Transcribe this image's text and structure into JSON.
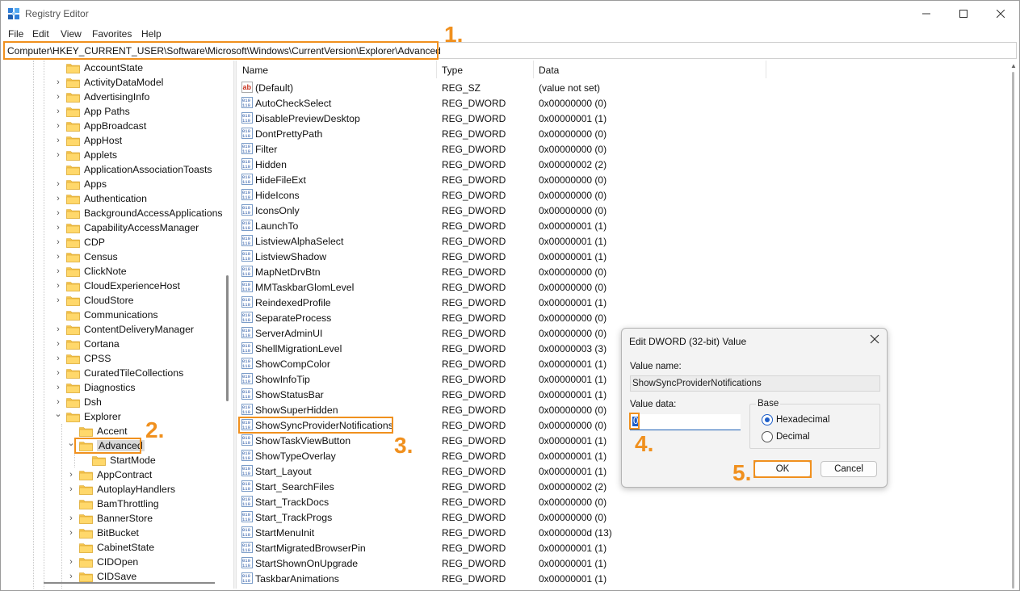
{
  "window": {
    "title": "Registry Editor"
  },
  "menu": [
    "File",
    "Edit",
    "View",
    "Favorites",
    "Help"
  ],
  "address": "Computer\\HKEY_CURRENT_USER\\Software\\Microsoft\\Windows\\CurrentVersion\\Explorer\\Advanced",
  "tree": {
    "items": [
      {
        "label": "AccountState",
        "level": 1,
        "has_children": false
      },
      {
        "label": "ActivityDataModel",
        "level": 1,
        "has_children": true
      },
      {
        "label": "AdvertisingInfo",
        "level": 1,
        "has_children": true
      },
      {
        "label": "App Paths",
        "level": 1,
        "has_children": true
      },
      {
        "label": "AppBroadcast",
        "level": 1,
        "has_children": true
      },
      {
        "label": "AppHost",
        "level": 1,
        "has_children": true
      },
      {
        "label": "Applets",
        "level": 1,
        "has_children": true
      },
      {
        "label": "ApplicationAssociationToasts",
        "level": 1,
        "has_children": false
      },
      {
        "label": "Apps",
        "level": 1,
        "has_children": true
      },
      {
        "label": "Authentication",
        "level": 1,
        "has_children": true
      },
      {
        "label": "BackgroundAccessApplications",
        "level": 1,
        "has_children": true
      },
      {
        "label": "CapabilityAccessManager",
        "level": 1,
        "has_children": true
      },
      {
        "label": "CDP",
        "level": 1,
        "has_children": true
      },
      {
        "label": "Census",
        "level": 1,
        "has_children": true
      },
      {
        "label": "ClickNote",
        "level": 1,
        "has_children": true
      },
      {
        "label": "CloudExperienceHost",
        "level": 1,
        "has_children": true
      },
      {
        "label": "CloudStore",
        "level": 1,
        "has_children": true
      },
      {
        "label": "Communications",
        "level": 1,
        "has_children": false
      },
      {
        "label": "ContentDeliveryManager",
        "level": 1,
        "has_children": true
      },
      {
        "label": "Cortana",
        "level": 1,
        "has_children": true
      },
      {
        "label": "CPSS",
        "level": 1,
        "has_children": true
      },
      {
        "label": "CuratedTileCollections",
        "level": 1,
        "has_children": true
      },
      {
        "label": "Diagnostics",
        "level": 1,
        "has_children": true
      },
      {
        "label": "Dsh",
        "level": 1,
        "has_children": true
      },
      {
        "label": "Explorer",
        "level": 1,
        "has_children": true,
        "expanded": true
      },
      {
        "label": "Accent",
        "level": 2,
        "has_children": false
      },
      {
        "label": "Advanced",
        "level": 2,
        "has_children": true,
        "expanded": true,
        "selected": true
      },
      {
        "label": "StartMode",
        "level": 3,
        "has_children": false
      },
      {
        "label": "AppContract",
        "level": 2,
        "has_children": true
      },
      {
        "label": "AutoplayHandlers",
        "level": 2,
        "has_children": true
      },
      {
        "label": "BamThrottling",
        "level": 2,
        "has_children": false
      },
      {
        "label": "BannerStore",
        "level": 2,
        "has_children": true
      },
      {
        "label": "BitBucket",
        "level": 2,
        "has_children": true
      },
      {
        "label": "CabinetState",
        "level": 2,
        "has_children": false
      },
      {
        "label": "CIDOpen",
        "level": 2,
        "has_children": true
      },
      {
        "label": "CIDSave",
        "level": 2,
        "has_children": true
      }
    ]
  },
  "list": {
    "columns": [
      "Name",
      "Type",
      "Data"
    ],
    "rows": [
      {
        "name": "(Default)",
        "type": "REG_SZ",
        "data": "(value not set)",
        "icon": "string-value-icon"
      },
      {
        "name": "AutoCheckSelect",
        "type": "REG_DWORD",
        "data": "0x00000000 (0)",
        "icon": "binary-value-icon"
      },
      {
        "name": "DisablePreviewDesktop",
        "type": "REG_DWORD",
        "data": "0x00000001 (1)",
        "icon": "binary-value-icon"
      },
      {
        "name": "DontPrettyPath",
        "type": "REG_DWORD",
        "data": "0x00000000 (0)",
        "icon": "binary-value-icon"
      },
      {
        "name": "Filter",
        "type": "REG_DWORD",
        "data": "0x00000000 (0)",
        "icon": "binary-value-icon"
      },
      {
        "name": "Hidden",
        "type": "REG_DWORD",
        "data": "0x00000002 (2)",
        "icon": "binary-value-icon"
      },
      {
        "name": "HideFileExt",
        "type": "REG_DWORD",
        "data": "0x00000000 (0)",
        "icon": "binary-value-icon"
      },
      {
        "name": "HideIcons",
        "type": "REG_DWORD",
        "data": "0x00000000 (0)",
        "icon": "binary-value-icon"
      },
      {
        "name": "IconsOnly",
        "type": "REG_DWORD",
        "data": "0x00000000 (0)",
        "icon": "binary-value-icon"
      },
      {
        "name": "LaunchTo",
        "type": "REG_DWORD",
        "data": "0x00000001 (1)",
        "icon": "binary-value-icon"
      },
      {
        "name": "ListviewAlphaSelect",
        "type": "REG_DWORD",
        "data": "0x00000001 (1)",
        "icon": "binary-value-icon"
      },
      {
        "name": "ListviewShadow",
        "type": "REG_DWORD",
        "data": "0x00000001 (1)",
        "icon": "binary-value-icon"
      },
      {
        "name": "MapNetDrvBtn",
        "type": "REG_DWORD",
        "data": "0x00000000 (0)",
        "icon": "binary-value-icon"
      },
      {
        "name": "MMTaskbarGlomLevel",
        "type": "REG_DWORD",
        "data": "0x00000000 (0)",
        "icon": "binary-value-icon"
      },
      {
        "name": "ReindexedProfile",
        "type": "REG_DWORD",
        "data": "0x00000001 (1)",
        "icon": "binary-value-icon"
      },
      {
        "name": "SeparateProcess",
        "type": "REG_DWORD",
        "data": "0x00000000 (0)",
        "icon": "binary-value-icon"
      },
      {
        "name": "ServerAdminUI",
        "type": "REG_DWORD",
        "data": "0x00000000 (0)",
        "icon": "binary-value-icon"
      },
      {
        "name": "ShellMigrationLevel",
        "type": "REG_DWORD",
        "data": "0x00000003 (3)",
        "icon": "binary-value-icon"
      },
      {
        "name": "ShowCompColor",
        "type": "REG_DWORD",
        "data": "0x00000001 (1)",
        "icon": "binary-value-icon"
      },
      {
        "name": "ShowInfoTip",
        "type": "REG_DWORD",
        "data": "0x00000001 (1)",
        "icon": "binary-value-icon"
      },
      {
        "name": "ShowStatusBar",
        "type": "REG_DWORD",
        "data": "0x00000001 (1)",
        "icon": "binary-value-icon"
      },
      {
        "name": "ShowSuperHidden",
        "type": "REG_DWORD",
        "data": "0x00000000 (0)",
        "icon": "binary-value-icon"
      },
      {
        "name": "ShowSyncProviderNotifications",
        "type": "REG_DWORD",
        "data": "0x00000000 (0)",
        "icon": "binary-value-icon",
        "highlighted": true
      },
      {
        "name": "ShowTaskViewButton",
        "type": "REG_DWORD",
        "data": "0x00000001 (1)",
        "icon": "binary-value-icon"
      },
      {
        "name": "ShowTypeOverlay",
        "type": "REG_DWORD",
        "data": "0x00000001 (1)",
        "icon": "binary-value-icon"
      },
      {
        "name": "Start_Layout",
        "type": "REG_DWORD",
        "data": "0x00000001 (1)",
        "icon": "binary-value-icon"
      },
      {
        "name": "Start_SearchFiles",
        "type": "REG_DWORD",
        "data": "0x00000002 (2)",
        "icon": "binary-value-icon"
      },
      {
        "name": "Start_TrackDocs",
        "type": "REG_DWORD",
        "data": "0x00000000 (0)",
        "icon": "binary-value-icon"
      },
      {
        "name": "Start_TrackProgs",
        "type": "REG_DWORD",
        "data": "0x00000000 (0)",
        "icon": "binary-value-icon"
      },
      {
        "name": "StartMenuInit",
        "type": "REG_DWORD",
        "data": "0x0000000d (13)",
        "icon": "binary-value-icon"
      },
      {
        "name": "StartMigratedBrowserPin",
        "type": "REG_DWORD",
        "data": "0x00000001 (1)",
        "icon": "binary-value-icon"
      },
      {
        "name": "StartShownOnUpgrade",
        "type": "REG_DWORD",
        "data": "0x00000001 (1)",
        "icon": "binary-value-icon"
      },
      {
        "name": "TaskbarAnimations",
        "type": "REG_DWORD",
        "data": "0x00000001 (1)",
        "icon": "binary-value-icon"
      }
    ]
  },
  "dialog": {
    "title": "Edit DWORD (32-bit) Value",
    "value_name_label": "Value name:",
    "value_name": "ShowSyncProviderNotifications",
    "value_data_label": "Value data:",
    "value_data": "0",
    "base_label": "Base",
    "base_options": [
      {
        "label": "Hexadecimal",
        "checked": true
      },
      {
        "label": "Decimal",
        "checked": false
      }
    ],
    "ok_label": "OK",
    "cancel_label": "Cancel"
  },
  "callouts": [
    "1.",
    "2.",
    "3.",
    "4.",
    "5."
  ],
  "colors": {
    "callout": "#f0901e",
    "selection": "#1e5ec8",
    "folder": "#f5c44e"
  }
}
